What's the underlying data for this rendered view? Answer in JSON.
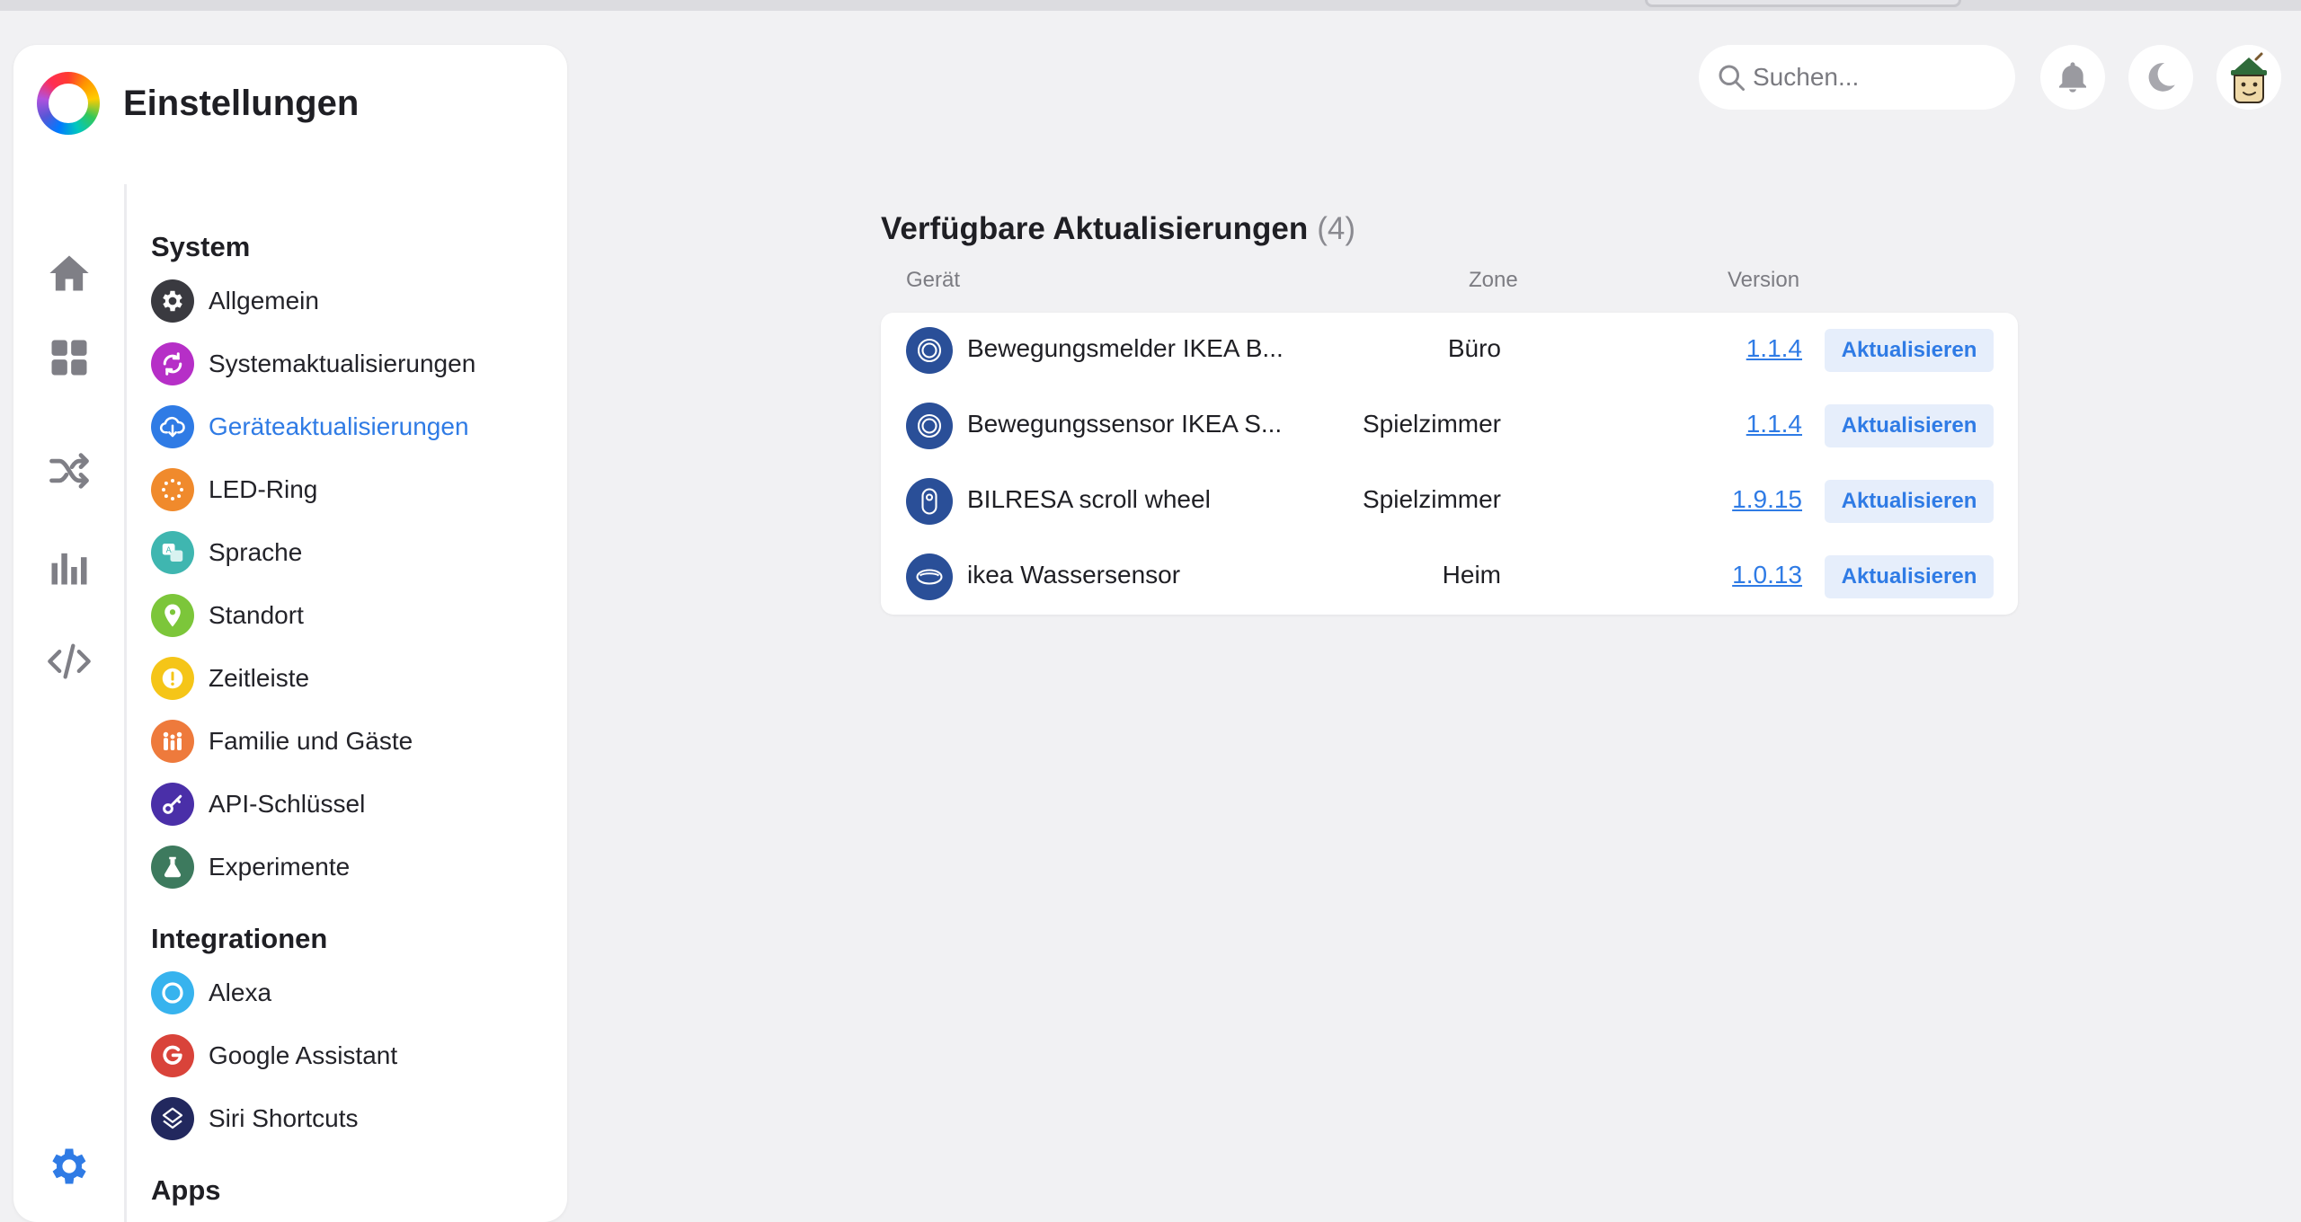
{
  "sidebar": {
    "title": "Einstellungen",
    "sections": [
      {
        "title": "System",
        "items": [
          {
            "label": "Allgemein",
            "icon": "gear-icon",
            "color": "#3a3a40",
            "active": false
          },
          {
            "label": "Systemaktualisierungen",
            "icon": "refresh-icon",
            "color": "#b62fc7",
            "active": false
          },
          {
            "label": "Geräteaktualisierungen",
            "icon": "cloud-download-icon",
            "color": "#2f7be5",
            "active": true
          },
          {
            "label": "LED-Ring",
            "icon": "led-ring-icon",
            "color": "#f08a2c",
            "active": false
          },
          {
            "label": "Sprache",
            "icon": "language-icon",
            "color": "#3fb6b0",
            "active": false
          },
          {
            "label": "Standort",
            "icon": "location-pin-icon",
            "color": "#7cc63a",
            "active": false
          },
          {
            "label": "Zeitleiste",
            "icon": "alert-icon",
            "color": "#f5c518",
            "active": false
          },
          {
            "label": "Familie und Gäste",
            "icon": "family-icon",
            "color": "#ee7a3c",
            "active": false
          },
          {
            "label": "API-Schlüssel",
            "icon": "key-icon",
            "color": "#4a2fa8",
            "active": false
          },
          {
            "label": "Experimente",
            "icon": "flask-icon",
            "color": "#3d7a5e",
            "active": false
          }
        ]
      },
      {
        "title": "Integrationen",
        "items": [
          {
            "label": "Alexa",
            "icon": "alexa-icon",
            "color": "#37b3ee",
            "active": false
          },
          {
            "label": "Google Assistant",
            "icon": "google-icon",
            "color": "#d9433a",
            "active": false
          },
          {
            "label": "Siri Shortcuts",
            "icon": "siri-shortcuts-icon",
            "color": "#22285e",
            "active": false
          }
        ]
      },
      {
        "title": "Apps",
        "items": []
      }
    ]
  },
  "rail": [
    "home-icon",
    "dashboard-icon",
    "shuffle-icon",
    "chart-icon",
    "code-icon",
    "settings-gear-icon"
  ],
  "header": {
    "search_placeholder": "Suchen...",
    "buttons": [
      "bell-icon",
      "moon-icon"
    ],
    "avatar": "avatar"
  },
  "updates": {
    "title": "Verfügbare Aktualisierungen",
    "count": "(4)",
    "columns": {
      "device": "Gerät",
      "zone": "Zone",
      "version": "Version"
    },
    "rows": [
      {
        "name": "Bewegungsmelder IKEA B...",
        "zone": "Büro",
        "version": "1.1.4",
        "action": "Aktualisieren",
        "icon": "motion-sensor-icon"
      },
      {
        "name": "Bewegungssensor IKEA S...",
        "zone": "Spielzimmer",
        "version": "1.1.4",
        "action": "Aktualisieren",
        "icon": "motion-sensor-icon"
      },
      {
        "name": "BILRESA scroll wheel",
        "zone": "Spielzimmer",
        "version": "1.9.15",
        "action": "Aktualisieren",
        "icon": "remote-icon"
      },
      {
        "name": "ikea Wassersensor",
        "zone": "Heim",
        "version": "1.0.13",
        "action": "Aktualisieren",
        "icon": "water-sensor-icon"
      }
    ]
  },
  "colors": {
    "accent": "#2f7be5",
    "background": "#f1f1f3",
    "device_icon": "#2a4f98"
  }
}
